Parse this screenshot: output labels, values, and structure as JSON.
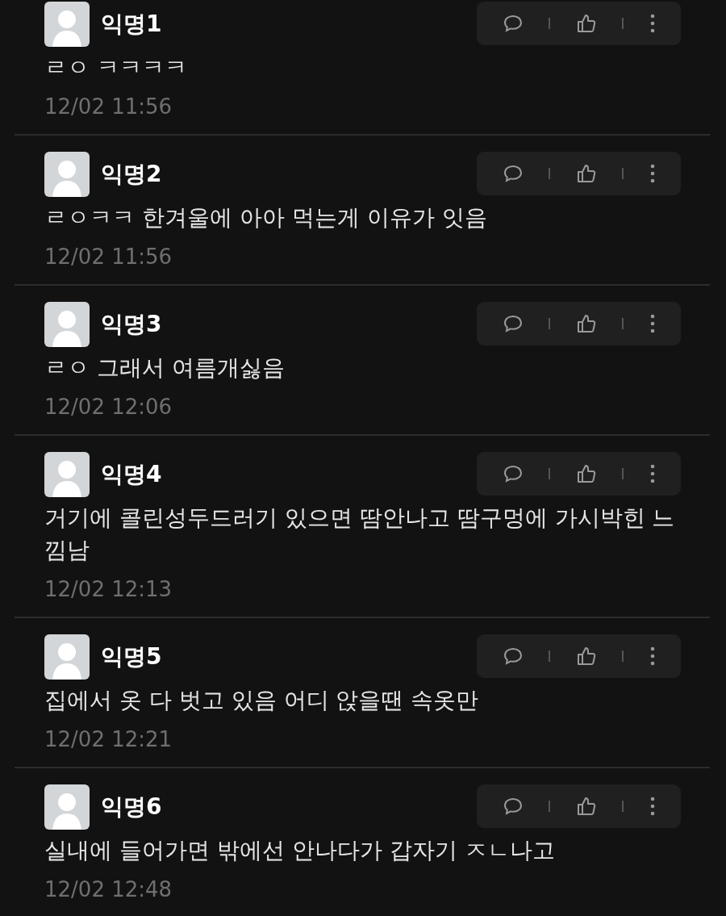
{
  "comments": [
    {
      "author": "익명1",
      "body": "ㄹㅇ ㅋㅋㅋㅋ",
      "time": "12/02 11:56"
    },
    {
      "author": "익명2",
      "body": "ㄹㅇㅋㅋ 한겨울에 아아 먹는게 이유가 잇음",
      "time": "12/02 11:56"
    },
    {
      "author": "익명3",
      "body": "ㄹㅇ 그래서 여름개싫음",
      "time": "12/02 12:06"
    },
    {
      "author": "익명4",
      "body": "거기에 콜린성두드러기 있으면 땀안나고 땀구멍에 가시박힌 느낌남",
      "time": "12/02 12:13"
    },
    {
      "author": "익명5",
      "body": "집에서 옷 다 벗고 있음 어디 앉을땐 속옷만",
      "time": "12/02 12:21"
    },
    {
      "author": "익명6",
      "body": "실내에 들어가면 밖에선 안나다가 갑자기 ㅈㄴ나고",
      "time": "12/02 12:48"
    }
  ]
}
